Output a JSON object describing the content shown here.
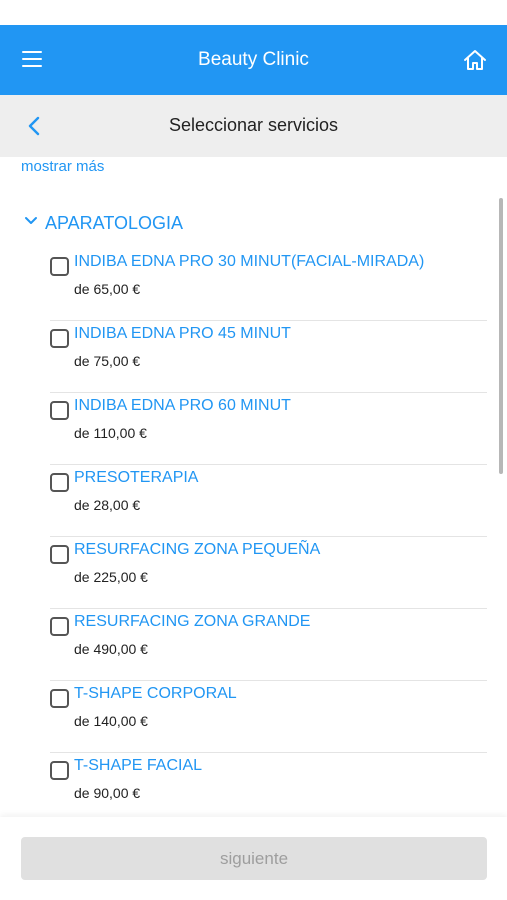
{
  "app_bar": {
    "title": "Beauty Clinic",
    "menu_icon": "hamburger-menu-icon",
    "home_icon": "home-icon",
    "color": "#2196f3"
  },
  "sub_bar": {
    "title": "Seleccionar servicios",
    "back_icon": "chevron-left-icon"
  },
  "show_more": "mostrar más",
  "category": {
    "label": "APARATOLOGIA",
    "icon": "chevron-down-icon",
    "expanded": true
  },
  "services": [
    {
      "name": "INDIBA EDNA PRO 30 MINUT(FACIAL-MIRADA)",
      "price": "de 65,00 €",
      "checked": false
    },
    {
      "name": "INDIBA EDNA PRO 45 MINUT",
      "price": "de 75,00 €",
      "checked": false
    },
    {
      "name": "INDIBA EDNA PRO 60 MINUT",
      "price": "de 110,00 €",
      "checked": false
    },
    {
      "name": "PRESOTERAPIA",
      "price": "de 28,00 €",
      "checked": false
    },
    {
      "name": "RESURFACING ZONA PEQUEÑA",
      "price": "de 225,00 €",
      "checked": false
    },
    {
      "name": "RESURFACING ZONA GRANDE",
      "price": "de 490,00 €",
      "checked": false
    },
    {
      "name": "T-SHAPE CORPORAL",
      "price": "de 140,00 €",
      "checked": false
    },
    {
      "name": "T-SHAPE FACIAL",
      "price": "de 90,00 €",
      "checked": false
    }
  ],
  "footer": {
    "next_label": "siguiente",
    "next_enabled": false
  }
}
